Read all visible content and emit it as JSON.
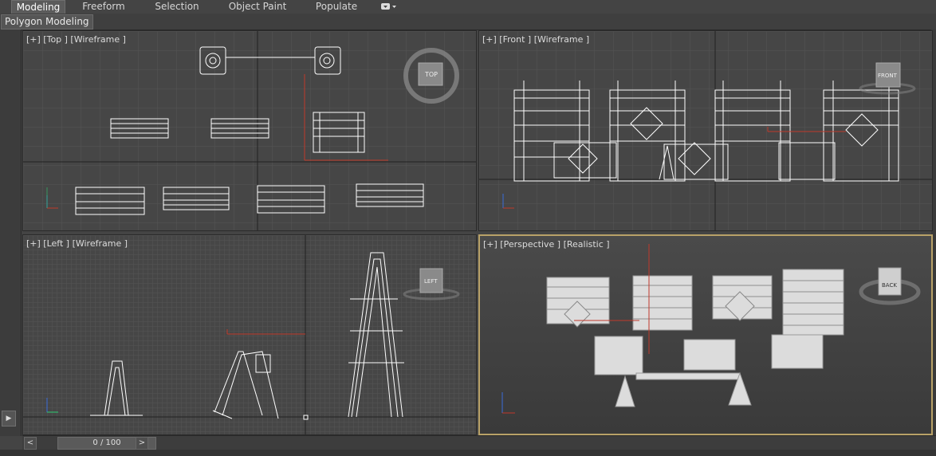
{
  "ribbon": {
    "tabs": [
      {
        "label": "Modeling",
        "active": true
      },
      {
        "label": "Freeform",
        "active": false
      },
      {
        "label": "Selection",
        "active": false
      },
      {
        "label": "Object Paint",
        "active": false
      },
      {
        "label": "Populate",
        "active": false
      }
    ],
    "dropdown_icon": "options-dropdown-icon"
  },
  "subtab": {
    "label": "Polygon Modeling"
  },
  "viewports": {
    "top": {
      "label": "[+] [Top ] [Wireframe ]",
      "viewcube_label": "TOP"
    },
    "front": {
      "label": "[+] [Front ] [Wireframe ]",
      "viewcube_label": "FRONT"
    },
    "left": {
      "label": "[+] [Left ] [Wireframe ]",
      "viewcube_label": "LEFT"
    },
    "perspective": {
      "label": "[+] [Perspective ] [Realistic ]",
      "viewcube_label": "BACK"
    }
  },
  "timeslider": {
    "frame": "0 / 100",
    "prev": "<",
    "next": ">"
  },
  "colors": {
    "active_viewport_border": "#b9a268",
    "axis_x": "#c0392b",
    "axis_y": "#2ecc71",
    "axis_z": "#3a6cd9"
  }
}
